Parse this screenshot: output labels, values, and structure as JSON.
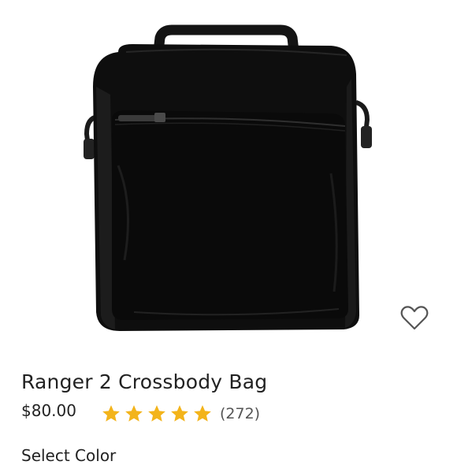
{
  "product": {
    "image_alt": "black crossbody bag",
    "name": "Ranger 2 Crossbody Bag",
    "price": "$80.00",
    "rating": {
      "value_stars": 5,
      "max_stars": 5,
      "count_label": "(272)",
      "star_color": "#f3b41b"
    }
  },
  "options": {
    "select_color_label": "Select Color"
  },
  "icons": {
    "wishlist": "heart-outline-icon",
    "star": "star-icon"
  }
}
